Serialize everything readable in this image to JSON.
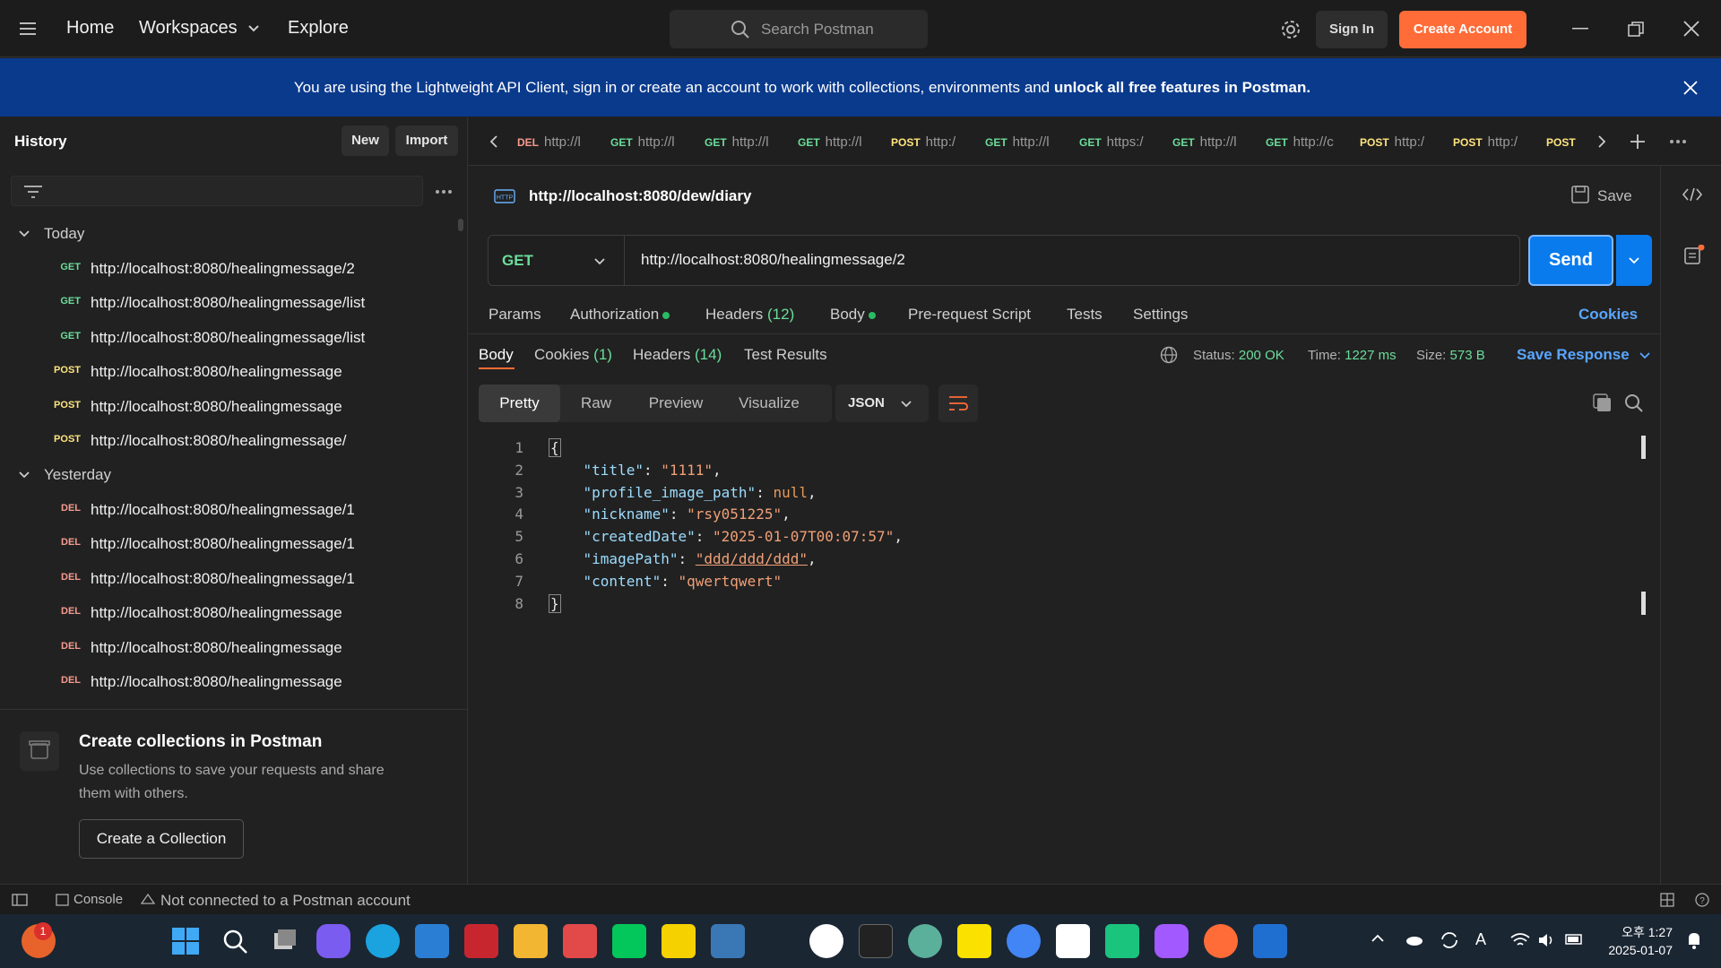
{
  "titlebar": {
    "nav": [
      "Home",
      "Workspaces",
      "Explore"
    ],
    "search_placeholder": "Search Postman",
    "sign_in": "Sign In",
    "create_account": "Create Account"
  },
  "banner": {
    "text": "You are using the Lightweight API Client, sign in or create an account to work with collections, environments and ",
    "bold": "unlock all free features in Postman."
  },
  "sidebar": {
    "title": "History",
    "new_label": "New",
    "import_label": "Import",
    "groups": [
      {
        "label": "Today",
        "items": [
          {
            "method": "GET",
            "url": "http://localhost:8080/healingmessage/2"
          },
          {
            "method": "GET",
            "url": "http://localhost:8080/healingmessage/list"
          },
          {
            "method": "GET",
            "url": "http://localhost:8080/healingmessage/list"
          },
          {
            "method": "POST",
            "url": "http://localhost:8080/healingmessage"
          },
          {
            "method": "POST",
            "url": "http://localhost:8080/healingmessage"
          },
          {
            "method": "POST",
            "url": "http://localhost:8080/healingmessage/"
          }
        ]
      },
      {
        "label": "Yesterday",
        "items": [
          {
            "method": "DEL",
            "url": "http://localhost:8080/healingmessage/1"
          },
          {
            "method": "DEL",
            "url": "http://localhost:8080/healingmessage/1"
          },
          {
            "method": "DEL",
            "url": "http://localhost:8080/healingmessage/1"
          },
          {
            "method": "DEL",
            "url": "http://localhost:8080/healingmessage"
          },
          {
            "method": "DEL",
            "url": "http://localhost:8080/healingmessage"
          },
          {
            "method": "DEL",
            "url": "http://localhost:8080/healingmessage"
          }
        ]
      }
    ],
    "collections": {
      "title": "Create collections in Postman",
      "desc_line1": "Use collections to save your requests and share",
      "desc_line2": "them with others.",
      "button": "Create a Collection"
    }
  },
  "open_tabs": [
    {
      "method": "DEL",
      "url": "http://l"
    },
    {
      "method": "GET",
      "url": "http://l"
    },
    {
      "method": "GET",
      "url": "http://l"
    },
    {
      "method": "GET",
      "url": "http://l"
    },
    {
      "method": "POST",
      "url": "http:/"
    },
    {
      "method": "GET",
      "url": "http://l"
    },
    {
      "method": "GET",
      "url": "https:/"
    },
    {
      "method": "GET",
      "url": "http://l"
    },
    {
      "method": "GET",
      "url": "http://c"
    },
    {
      "method": "POST",
      "url": "http:/"
    },
    {
      "method": "POST",
      "url": "http:/"
    },
    {
      "method": "POST",
      "url": ""
    }
  ],
  "request": {
    "title": "http://localhost:8080/dew/diary",
    "save_label": "Save",
    "method": "GET",
    "url": "http://localhost:8080/healingmessage/2",
    "send_label": "Send",
    "tabs": {
      "params": "Params",
      "authorization": "Authorization",
      "headers": "Headers",
      "headers_count": "(12)",
      "body": "Body",
      "pre_request": "Pre-request Script",
      "tests": "Tests",
      "settings": "Settings",
      "cookies": "Cookies"
    }
  },
  "response": {
    "tabs": {
      "body": "Body",
      "cookies": "Cookies",
      "cookies_count": "(1)",
      "headers": "Headers",
      "headers_count": "(14)",
      "test_results": "Test Results"
    },
    "status_label": "Status:",
    "status_value": "200 OK",
    "time_label": "Time:",
    "time_value": "1227 ms",
    "size_label": "Size:",
    "size_value": "573 B",
    "save_response": "Save Response",
    "view_tabs": [
      "Pretty",
      "Raw",
      "Preview",
      "Visualize"
    ],
    "format": "JSON",
    "line_numbers": [
      "1",
      "2",
      "3",
      "4",
      "5",
      "6",
      "7",
      "8"
    ],
    "json": [
      {
        "key": "\"title\"",
        "value": "\"1111\"",
        "type": "string"
      },
      {
        "key": "\"profile_image_path\"",
        "value": "null",
        "type": "null"
      },
      {
        "key": "\"nickname\"",
        "value": "\"rsy051225\"",
        "type": "string"
      },
      {
        "key": "\"createdDate\"",
        "value": "\"2025-01-07T00:07:57\"",
        "type": "string"
      },
      {
        "key": "\"imagePath\"",
        "value": "\"ddd/ddd/ddd\"",
        "type": "string"
      },
      {
        "key": "\"content\"",
        "value": "\"qwertqwert\"",
        "type": "string"
      }
    ]
  },
  "statusbar": {
    "console": "Console",
    "connection": "Not connected to a Postman account"
  },
  "taskbar": {
    "time": "오후 1:27",
    "date": "2025-01-07",
    "notification_badge": "1"
  },
  "colors": {
    "accent": "#ff6c37",
    "send": "#097bed",
    "get": "#6bdd9a",
    "post": "#ffe47e",
    "del": "#f79a8e",
    "banner": "#0a3a8c"
  }
}
